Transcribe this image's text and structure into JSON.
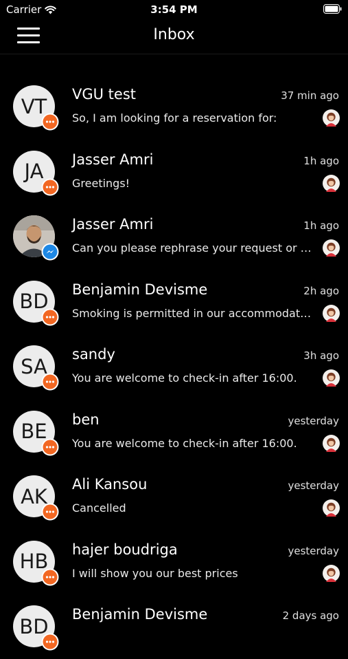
{
  "status_bar": {
    "carrier": "Carrier",
    "time": "3:54 PM"
  },
  "nav": {
    "title": "Inbox",
    "menu_icon": "hamburger-menu-icon"
  },
  "colors": {
    "background": "#000000",
    "badge_orange": "#f26722",
    "messenger_blue": "#1e88e5",
    "avatar_bg": "#ececec"
  },
  "conversations": [
    {
      "initials": "VT",
      "name": "VGU test",
      "time": "37 min ago",
      "preview": "So, I am looking for a reservation for:",
      "channel": "chat-bubble-icon"
    },
    {
      "initials": "JA",
      "name": "Jasser Amri",
      "time": "1h ago",
      "preview": "Greetings!",
      "channel": "chat-bubble-icon"
    },
    {
      "initials": "",
      "name": "Jasser Amri",
      "time": "1h ago",
      "preview": "Can you please rephrase your request or u…",
      "channel": "messenger-icon"
    },
    {
      "initials": "BD",
      "name": "Benjamin Devisme",
      "time": "2h ago",
      "preview": "Smoking is permitted in our accommodat…",
      "channel": "chat-bubble-icon"
    },
    {
      "initials": "SA",
      "name": "sandy",
      "time": "3h ago",
      "preview": "You are welcome to check-in after 16:00.",
      "channel": "chat-bubble-icon"
    },
    {
      "initials": "BE",
      "name": "ben",
      "time": "yesterday",
      "preview": "You are welcome to check-in after 16:00.",
      "channel": "chat-bubble-icon"
    },
    {
      "initials": "AK",
      "name": "Ali Kansou",
      "time": "yesterday",
      "preview": "Cancelled",
      "channel": "chat-bubble-icon"
    },
    {
      "initials": "HB",
      "name": "hajer boudriga",
      "time": "yesterday",
      "preview": "I will show you our best prices",
      "channel": "chat-bubble-icon"
    },
    {
      "initials": "BD",
      "name": "Benjamin Devisme",
      "time": "2 days ago",
      "preview": "",
      "channel": "chat-bubble-icon"
    }
  ]
}
